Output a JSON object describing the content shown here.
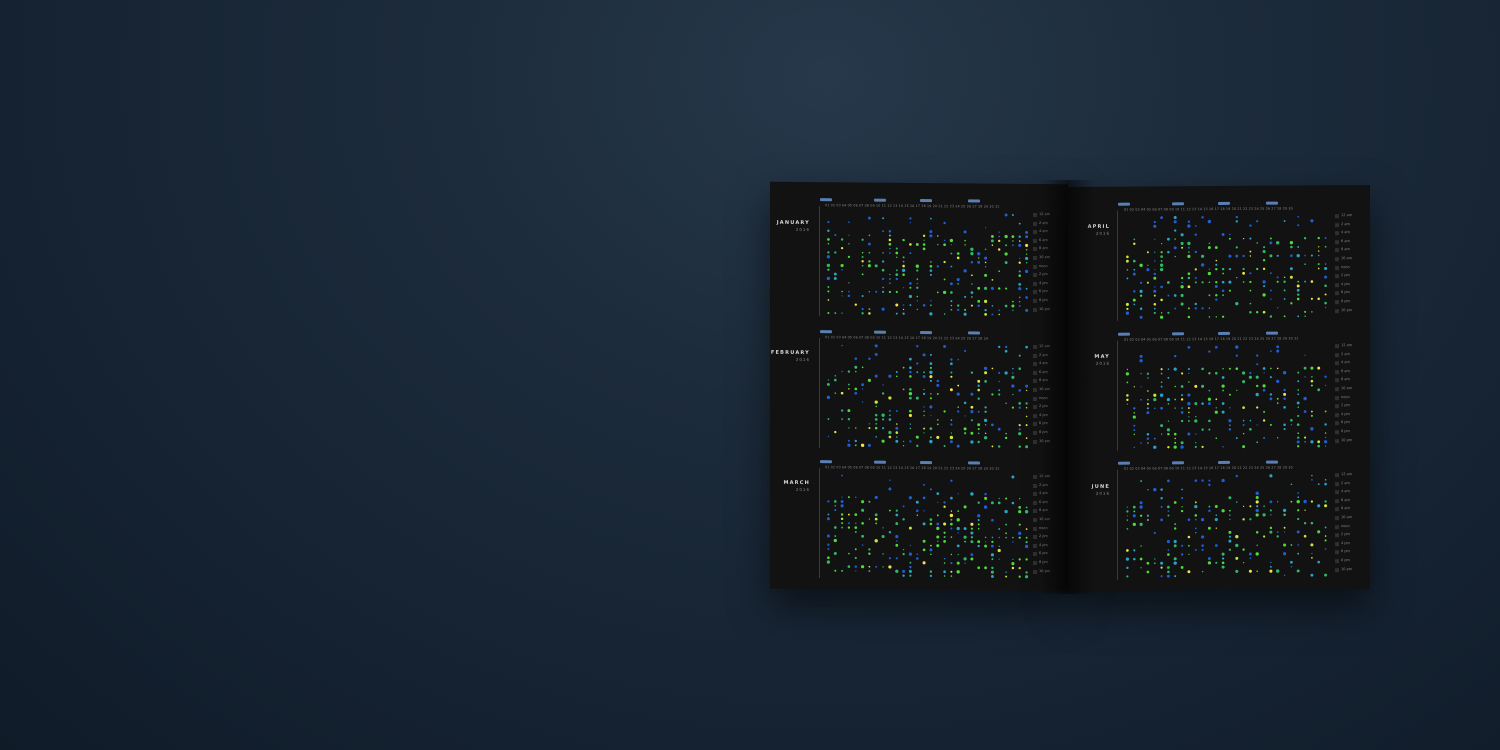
{
  "background": {
    "top_color": "#26384a",
    "bottom_color": "#101b28"
  },
  "magazine": {
    "page_color": "#121212",
    "dot_colors": [
      "#1f5fd6",
      "#2aa3c8",
      "#2fb86a",
      "#4fd93a",
      "#c9e63a",
      "#f2e34a"
    ],
    "hour_labels": [
      "12 am",
      "2 am",
      "4 am",
      "6 am",
      "8 am",
      "10 am",
      "noon",
      "2 pm",
      "4 pm",
      "6 pm",
      "8 pm",
      "10 pm"
    ],
    "left_page": {
      "months": [
        {
          "name": "JANUARY",
          "year": "2016",
          "days": "01 02 03 04 05 06 07 08 09 10 11 12 13 14 15 16 17 18 19 20 21 22 23 24 25 26 27 28 29 30 31"
        },
        {
          "name": "FEBRUARY",
          "year": "2016",
          "days": "01 02 03 04 05 06 07 08 09 10 11 12 13 14 15 16 17 18 19 20 21 22 23 24 25 26 27 28 29"
        },
        {
          "name": "MARCH",
          "year": "2016",
          "days": "01 02 03 04 05 06 07 08 09 10 11 12 13 14 15 16 17 18 19 20 21 22 23 24 25 26 27 28 29 30 31"
        }
      ]
    },
    "right_page": {
      "months": [
        {
          "name": "APRIL",
          "year": "2016",
          "days": "01 02 03 04 05 06 07 08 09 10 11 12 13 14 15 16 17 18 19 20 21 22 23 24 25 26 27 28 29 30"
        },
        {
          "name": "MAY",
          "year": "2016",
          "days": "01 02 03 04 05 06 07 08 09 10 11 12 13 14 15 16 17 18 19 20 21 22 23 24 25 26 27 28 29 30 31"
        },
        {
          "name": "JUNE",
          "year": "2016",
          "days": "01 02 03 04 05 06 07 08 09 10 11 12 13 14 15 16 17 18 19 20 21 22 23 24 25 26 27 28 29 30"
        }
      ]
    }
  }
}
